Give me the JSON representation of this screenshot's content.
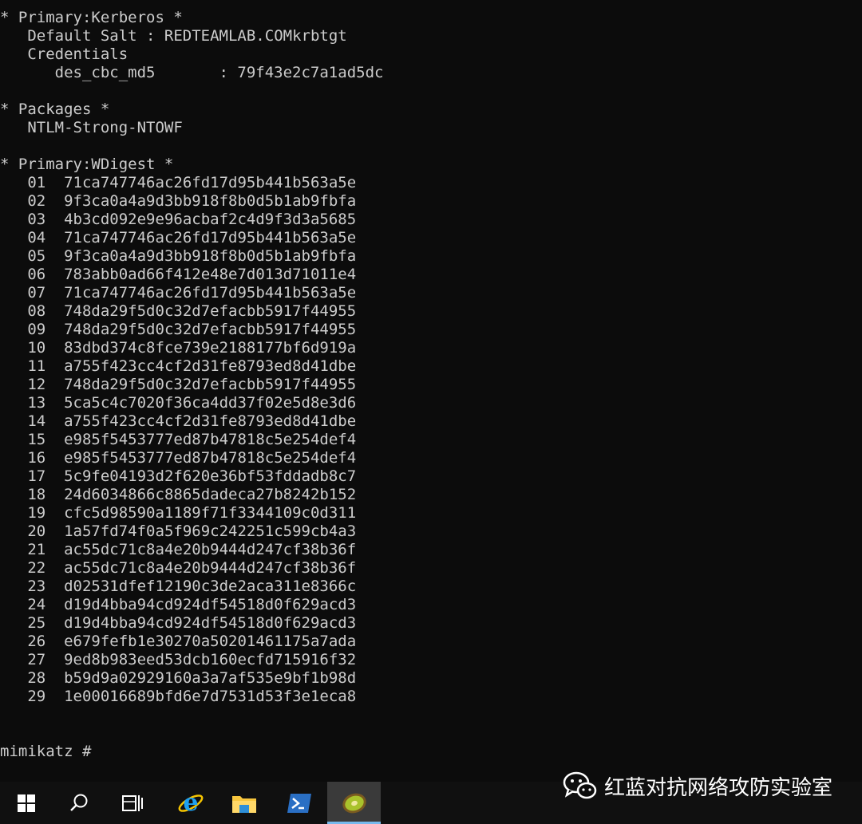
{
  "terminal": {
    "kerberos": {
      "header": "* Primary:Kerberos *",
      "default_salt_label": "Default Salt : ",
      "default_salt_value": "REDTEAMLAB.COMkrbtgt",
      "credentials_label": "Credentials",
      "des_label": "des_cbc_md5       : ",
      "des_value": "79f43e2c7a1ad5dc"
    },
    "packages": {
      "header": "* Packages *",
      "value": "NTLM-Strong-NTOWF"
    },
    "wdigest": {
      "header": "* Primary:WDigest *",
      "hashes": [
        {
          "idx": "01",
          "hash": "71ca747746ac26fd17d95b441b563a5e"
        },
        {
          "idx": "02",
          "hash": "9f3ca0a4a9d3bb918f8b0d5b1ab9fbfa"
        },
        {
          "idx": "03",
          "hash": "4b3cd092e9e96acbaf2c4d9f3d3a5685"
        },
        {
          "idx": "04",
          "hash": "71ca747746ac26fd17d95b441b563a5e"
        },
        {
          "idx": "05",
          "hash": "9f3ca0a4a9d3bb918f8b0d5b1ab9fbfa"
        },
        {
          "idx": "06",
          "hash": "783abb0ad66f412e48e7d013d71011e4"
        },
        {
          "idx": "07",
          "hash": "71ca747746ac26fd17d95b441b563a5e"
        },
        {
          "idx": "08",
          "hash": "748da29f5d0c32d7efacbb5917f44955"
        },
        {
          "idx": "09",
          "hash": "748da29f5d0c32d7efacbb5917f44955"
        },
        {
          "idx": "10",
          "hash": "83dbd374c8fce739e2188177bf6d919a"
        },
        {
          "idx": "11",
          "hash": "a755f423cc4cf2d31fe8793ed8d41dbe"
        },
        {
          "idx": "12",
          "hash": "748da29f5d0c32d7efacbb5917f44955"
        },
        {
          "idx": "13",
          "hash": "5ca5c4c7020f36ca4dd37f02e5d8e3d6"
        },
        {
          "idx": "14",
          "hash": "a755f423cc4cf2d31fe8793ed8d41dbe"
        },
        {
          "idx": "15",
          "hash": "e985f5453777ed87b47818c5e254def4"
        },
        {
          "idx": "16",
          "hash": "e985f5453777ed87b47818c5e254def4"
        },
        {
          "idx": "17",
          "hash": "5c9fe04193d2f620e36bf53fddadb8c7"
        },
        {
          "idx": "18",
          "hash": "24d6034866c8865dadeca27b8242b152"
        },
        {
          "idx": "19",
          "hash": "cfc5d98590a1189f71f3344109c0d311"
        },
        {
          "idx": "20",
          "hash": "1a57fd74f0a5f969c242251c599cb4a3"
        },
        {
          "idx": "21",
          "hash": "ac55dc71c8a4e20b9444d247cf38b36f"
        },
        {
          "idx": "22",
          "hash": "ac55dc71c8a4e20b9444d247cf38b36f"
        },
        {
          "idx": "23",
          "hash": "d02531dfef12190c3de2aca311e8366c"
        },
        {
          "idx": "24",
          "hash": "d19d4bba94cd924df54518d0f629acd3"
        },
        {
          "idx": "25",
          "hash": "d19d4bba94cd924df54518d0f629acd3"
        },
        {
          "idx": "26",
          "hash": "e679fefb1e30270a50201461175a7ada"
        },
        {
          "idx": "27",
          "hash": "9ed8b983eed53dcb160ecfd715916f32"
        },
        {
          "idx": "28",
          "hash": "b59d9a02929160a3a7af535e9bf1b98d"
        },
        {
          "idx": "29",
          "hash": "1e00016689bfd6e7d7531d53f3e1eca8"
        }
      ]
    },
    "prompt": "mimikatz # "
  },
  "taskbar": {
    "icons": [
      "windows-start-icon",
      "search-icon",
      "task-view-icon",
      "internet-explorer-icon",
      "file-explorer-icon",
      "powershell-icon",
      "mimikatz-kiwi-icon"
    ],
    "accent_color": "#76b9ed"
  },
  "watermark": {
    "text": "红蓝对抗网络攻防实验室",
    "icon": "wechat-icon"
  }
}
